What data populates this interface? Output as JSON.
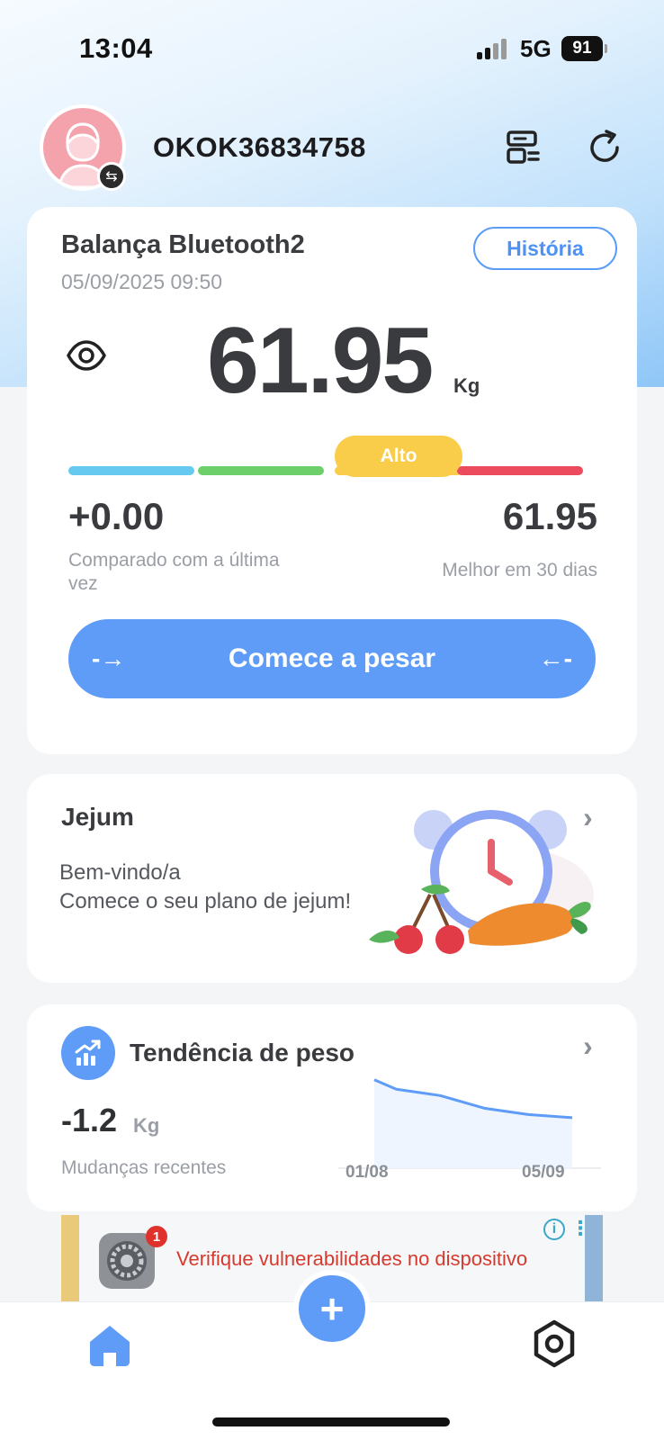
{
  "status": {
    "time": "13:04",
    "network": "5G",
    "battery": "91"
  },
  "header": {
    "username": "OKOK36834758",
    "device_icon": "device-list-icon",
    "sync_icon": "refresh-icon",
    "avatar_icon": "avatar-female-icon"
  },
  "weight_card": {
    "device_name": "Balança Bluetooth2",
    "datetime": "05/09/2025 09:50",
    "history_label": "História",
    "weight": "61.95",
    "unit": "Kg",
    "status_label": "Alto",
    "bar_colors": [
      "#66c9f0",
      "#6ccf6a",
      "#f9cc4a",
      "#ec4a5d"
    ],
    "delta_value": "+0.00",
    "delta_label": "Comparado com a última vez",
    "best_value": "61.95",
    "best_label": "Melhor em 30 dias",
    "start_label": "Comece a pesar",
    "arrow_left": "-→",
    "arrow_right": "←-"
  },
  "fasting_card": {
    "title": "Jejum",
    "welcome": "Bem-vindo/a",
    "subtitle": "Comece o seu plano de jejum!"
  },
  "trend_card": {
    "title": "Tendência de peso",
    "value": "-1.2",
    "unit": "Kg",
    "label": "Mudanças recentes",
    "x_start": "01/08",
    "x_end": "05/09"
  },
  "chart_data": {
    "type": "area",
    "x": [
      "01/08",
      "05/09"
    ],
    "series": [
      {
        "values": [
          63.1,
          62.8,
          62.7,
          62.6,
          62.4,
          62.2,
          62.1,
          62.0,
          61.95,
          61.9
        ]
      }
    ],
    "xlabel": "",
    "ylabel": ""
  },
  "ad": {
    "text": "Verifique vulnerabilidades no dispositivo",
    "badge": "1",
    "info": "i",
    "more": "⋮"
  },
  "tabbar": {
    "add_label": "+"
  },
  "colors": {
    "accent": "#5e9cf7",
    "alert": "#f9cc4a"
  }
}
